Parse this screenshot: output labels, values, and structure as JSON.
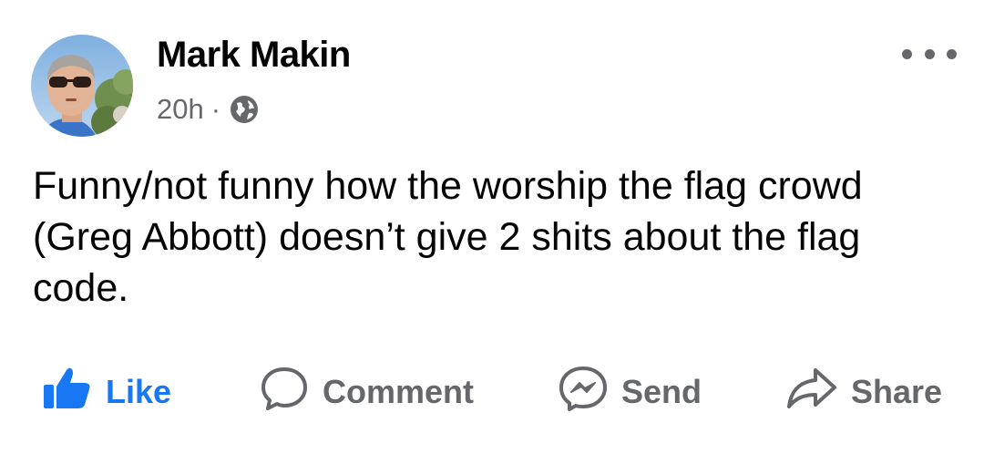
{
  "post": {
    "author": "Mark Makin",
    "time": "20h",
    "separator": "·",
    "audience_icon": "globe-icon",
    "more_icon": "more-options-icon",
    "text": "Funny/not funny how the worship the flag crowd (Greg Abbott) doesn’t give 2 shits about the flag code."
  },
  "actions": {
    "like": "Like",
    "comment": "Comment",
    "send": "Send",
    "share": "Share"
  },
  "colors": {
    "like_blue": "#1877f2",
    "secondary_gray": "#65676b",
    "text_black": "#050505"
  }
}
